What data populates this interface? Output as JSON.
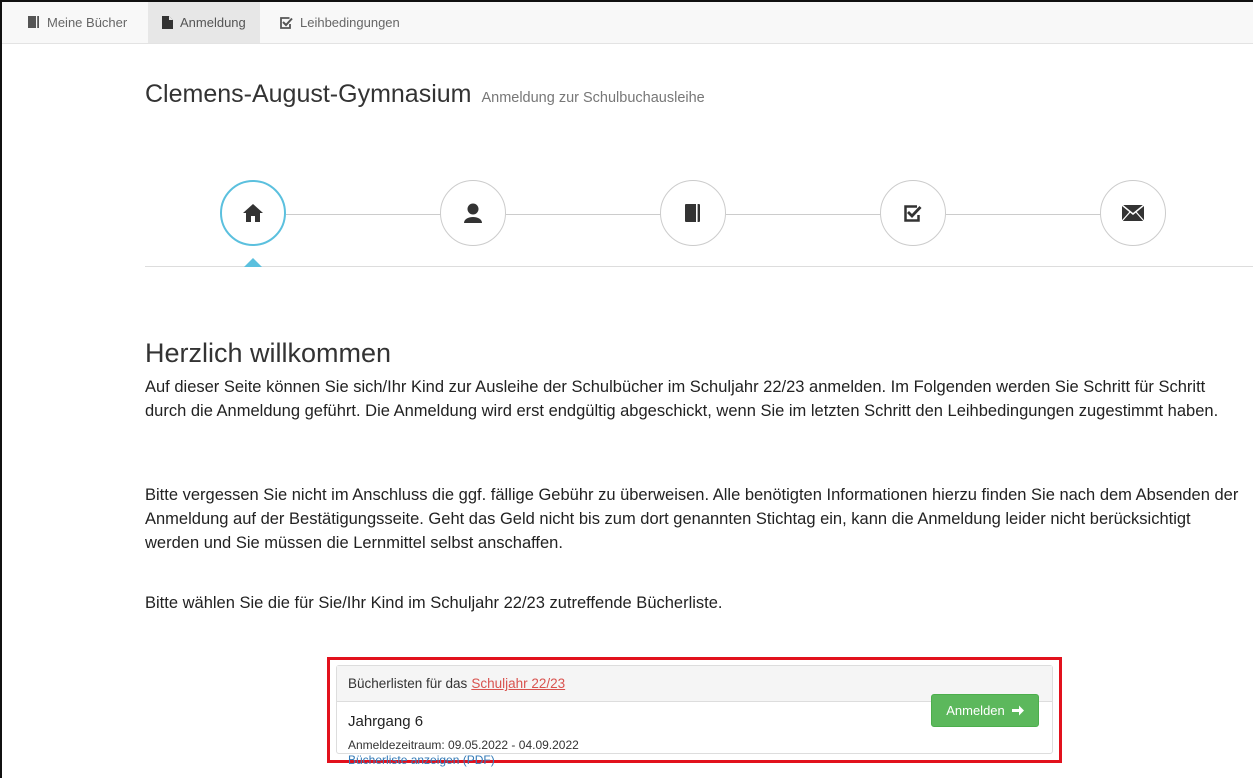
{
  "nav": {
    "items": [
      {
        "label": "Meine Bücher",
        "icon": "book-icon"
      },
      {
        "label": "Anmeldung",
        "icon": "file-icon"
      },
      {
        "label": "Leihbedingungen",
        "icon": "check-square-icon"
      }
    ],
    "active_index": 1
  },
  "header": {
    "title": "Clemens-August-Gymnasium",
    "subtitle": "Anmeldung zur Schulbuchausleihe"
  },
  "stepper": {
    "steps": [
      "home-icon",
      "user-icon",
      "book-icon",
      "check-square-icon",
      "envelope-icon"
    ],
    "active_index": 0,
    "accent_color": "#5bc0de"
  },
  "main": {
    "heading": "Herzlich willkommen",
    "paragraph1": "Auf dieser Seite können Sie sich/Ihr Kind zur Ausleihe der Schulbücher im Schuljahr 22/23 anmelden. Im Folgenden werden Sie Schritt für Schritt durch die Anmeldung geführt. Die Anmeldung wird erst endgültig abgeschickt, wenn Sie im letzten Schritt den Leihbedingungen zugestimmt haben.",
    "paragraph2": "Bitte vergessen Sie nicht im Anschluss die ggf. fällige Gebühr zu überweisen. Alle benötigten Informationen hierzu finden Sie nach dem Absenden der Anmeldung auf der Bestätigungsseite. Geht das Geld nicht bis zum dort genannten Stichtag ein, kann die Anmeldung leider nicht berücksichtigt werden und Sie müssen die Lernmittel selbst anschaffen.",
    "paragraph3": "Bitte wählen Sie die für Sie/Ihr Kind im Schuljahr 22/23 zutreffende Bücherliste."
  },
  "booklists": {
    "header_prefix": "Bücherlisten für das",
    "header_link": "Schuljahr 22/23",
    "entries": [
      {
        "grade": "Jahrgang 6",
        "period": "Anmeldezeitraum: 09.05.2022 - 04.09.2022",
        "pdf_link": "Bücherliste anzeigen (PDF)",
        "button_label": "Anmelden"
      }
    ],
    "highlight_color": "#e2111d",
    "button_color": "#5cb85c"
  }
}
